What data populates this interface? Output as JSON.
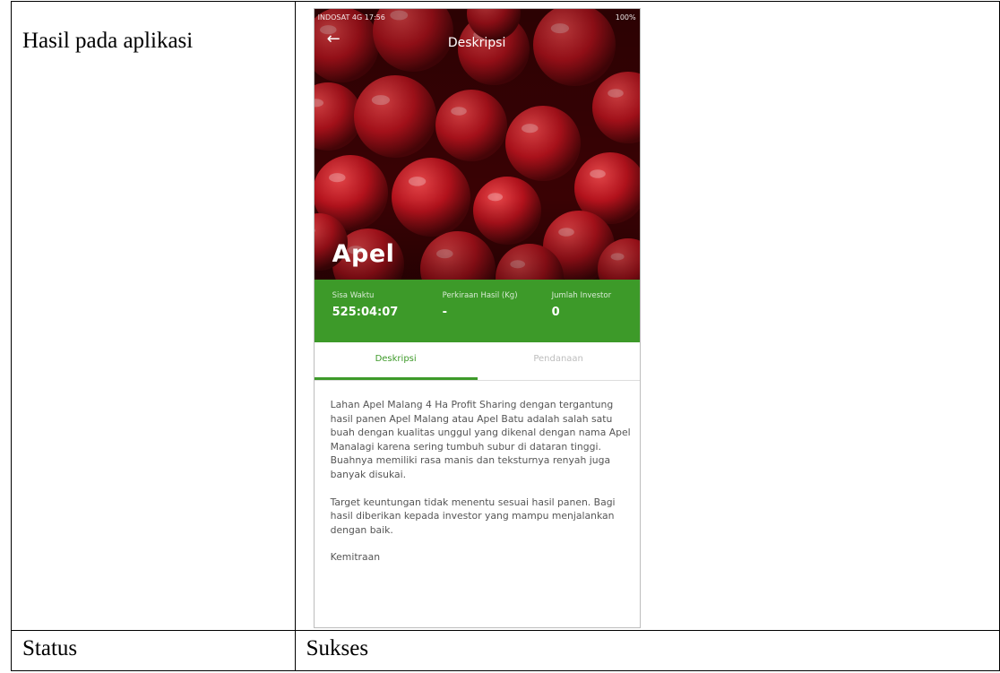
{
  "table": {
    "row1_label": "Hasil pada aplikasi",
    "row2_label": "Status",
    "row2_value": "Sukses"
  },
  "app": {
    "status_left": "INDOSAT 4G 17:56",
    "status_right": "100%",
    "title": "Deskripsi",
    "hero_title": "Apel",
    "stats": [
      {
        "label": "Sisa Waktu",
        "value": "525:04:07"
      },
      {
        "label": "Perkiraan Hasil (Kg)",
        "value": "-"
      },
      {
        "label": "Jumlah Investor",
        "value": "0"
      }
    ],
    "tabs": [
      "Deskripsi",
      "Pendanaan"
    ],
    "description": [
      "Lahan Apel Malang 4 Ha Profit Sharing dengan tergantung hasil panen Apel Malang atau Apel Batu adalah salah satu buah dengan kualitas unggul yang dikenal dengan nama Apel Manalagi karena sering tumbuh subur di dataran tinggi. Buahnya memiliki rasa manis dan teksturnya renyah juga banyak disukai.",
      "Target keuntungan tidak menentu sesuai hasil panen. Bagi hasil diberikan kepada investor yang mampu menjalankan dengan baik.",
      "Kemitraan"
    ]
  },
  "colors": {
    "green": "#3d9a29",
    "apple_red": "#b3121c"
  }
}
